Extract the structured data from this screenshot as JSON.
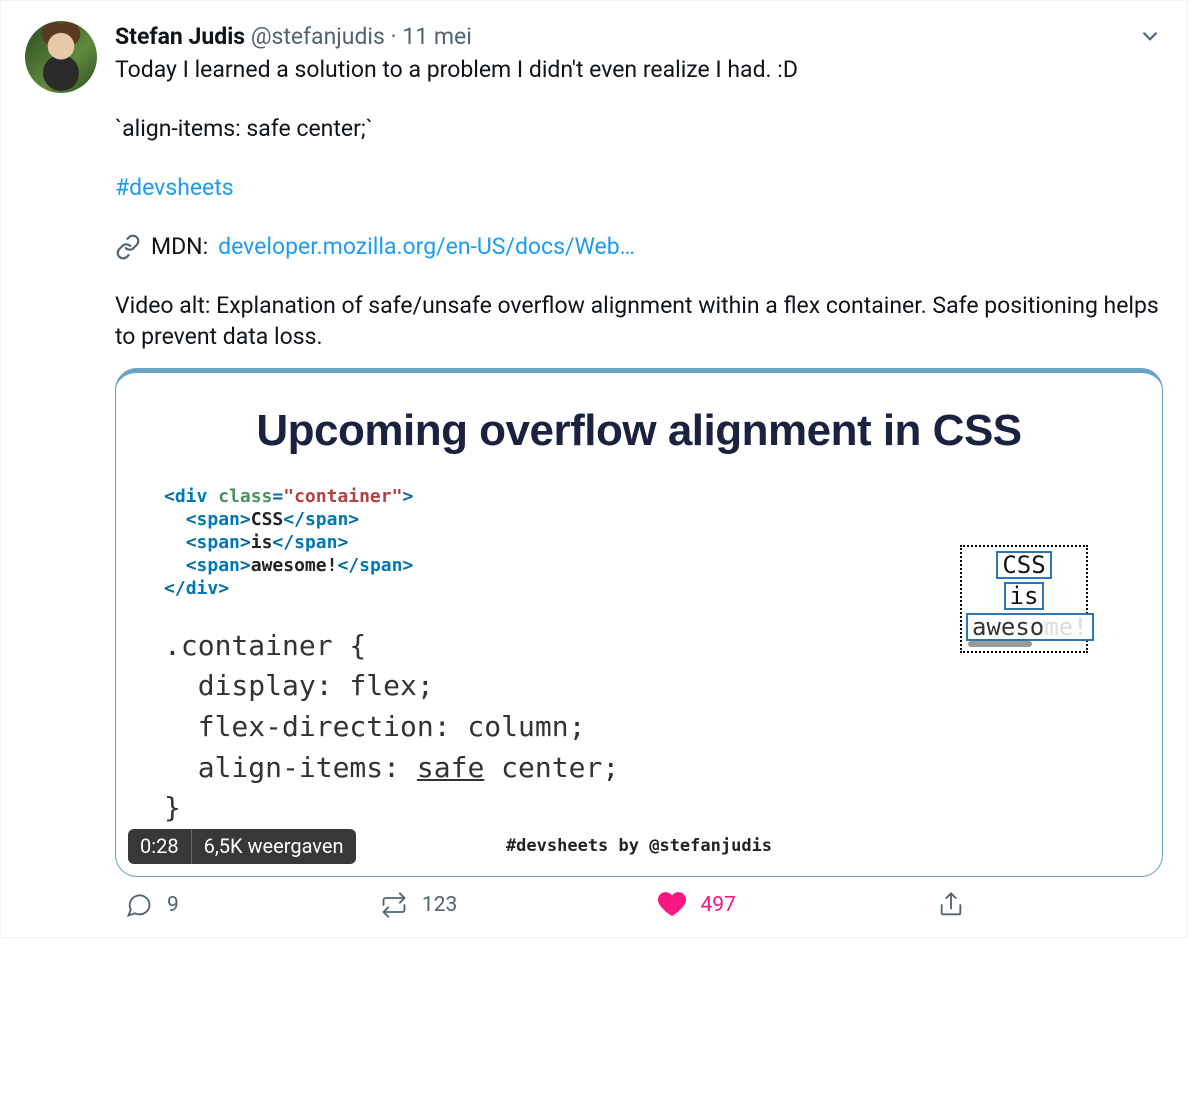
{
  "author": {
    "name": "Stefan Judis",
    "handle": "@stefanjudis",
    "date": "11 mei"
  },
  "body": {
    "line1": "Today I learned a solution to a problem I didn't even realize I had. :D",
    "line2": "`align-items: safe center;`",
    "hashtag": "#devsheets",
    "mdn_label": "MDN:",
    "mdn_link": "developer.mozilla.org/en-US/docs/Web…",
    "alt": "Video alt: Explanation of safe/unsafe overflow alignment within a flex container. Safe positioning helps to prevent data loss."
  },
  "media": {
    "title": "Upcoming overflow alignment in CSS",
    "html_lines": [
      [
        {
          "t": "ct",
          "v": "<"
        },
        {
          "t": "cn",
          "v": "div"
        },
        {
          "t": "",
          "v": " "
        },
        {
          "t": "ca",
          "v": "class"
        },
        {
          "t": "ct",
          "v": "="
        },
        {
          "t": "cs",
          "v": "\"container\""
        },
        {
          "t": "ct",
          "v": ">"
        }
      ],
      [
        {
          "t": "",
          "v": "  "
        },
        {
          "t": "ct",
          "v": "<"
        },
        {
          "t": "cn",
          "v": "span"
        },
        {
          "t": "ct",
          "v": ">"
        },
        {
          "t": "",
          "v": "CSS"
        },
        {
          "t": "ct",
          "v": "</"
        },
        {
          "t": "cn",
          "v": "span"
        },
        {
          "t": "ct",
          "v": ">"
        }
      ],
      [
        {
          "t": "",
          "v": "  "
        },
        {
          "t": "ct",
          "v": "<"
        },
        {
          "t": "cn",
          "v": "span"
        },
        {
          "t": "ct",
          "v": ">"
        },
        {
          "t": "",
          "v": "is"
        },
        {
          "t": "ct",
          "v": "</"
        },
        {
          "t": "cn",
          "v": "span"
        },
        {
          "t": "ct",
          "v": ">"
        }
      ],
      [
        {
          "t": "",
          "v": "  "
        },
        {
          "t": "ct",
          "v": "<"
        },
        {
          "t": "cn",
          "v": "span"
        },
        {
          "t": "ct",
          "v": ">"
        },
        {
          "t": "",
          "v": "awesome!"
        },
        {
          "t": "ct",
          "v": "</"
        },
        {
          "t": "cn",
          "v": "span"
        },
        {
          "t": "ct",
          "v": ">"
        }
      ],
      [
        {
          "t": "ct",
          "v": "</"
        },
        {
          "t": "cn",
          "v": "div"
        },
        {
          "t": "ct",
          "v": ">"
        }
      ]
    ],
    "css_lines": [
      ".container {",
      "  display: flex;",
      "  flex-direction: column;",
      "  align-items: safe center;",
      "}"
    ],
    "css_underline_token": "safe",
    "demo": {
      "items": [
        "CSS",
        "is"
      ],
      "overflow_visible": "aweso",
      "overflow_hidden": "me!"
    },
    "footer": "#devsheets by @stefanjudis",
    "duration": "0:28",
    "views": "6,5K weergaven"
  },
  "actions": {
    "replies": "9",
    "retweets": "123",
    "likes": "497"
  }
}
